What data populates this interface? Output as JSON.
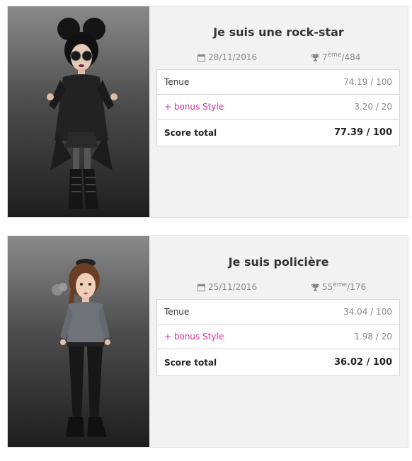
{
  "cards": [
    {
      "title": "Je suis une rock-star",
      "date": "28/11/2016",
      "rank": "7",
      "rank_suffix": "ème",
      "rank_total": "/484",
      "rows": [
        {
          "label": "Tenue",
          "value": "74.19 / 100"
        },
        {
          "label": "+ bonus Style",
          "value": "3.20 / 20"
        },
        {
          "label": "Score total",
          "value": "77.39 / 100"
        }
      ]
    },
    {
      "title": "Je suis policière",
      "date": "25/11/2016",
      "rank": "55",
      "rank_suffix": "ème",
      "rank_total": "/176",
      "rows": [
        {
          "label": "Tenue",
          "value": "34.04 / 100"
        },
        {
          "label": "+ bonus Style",
          "value": "1.98 / 20"
        },
        {
          "label": "Score total",
          "value": "36.02 / 100"
        }
      ]
    }
  ],
  "icons": {
    "date": "calendar-icon",
    "rank": "trophy-icon"
  },
  "colors": {
    "bonus": "#d6309a",
    "card_bg": "#f2f2f2"
  }
}
